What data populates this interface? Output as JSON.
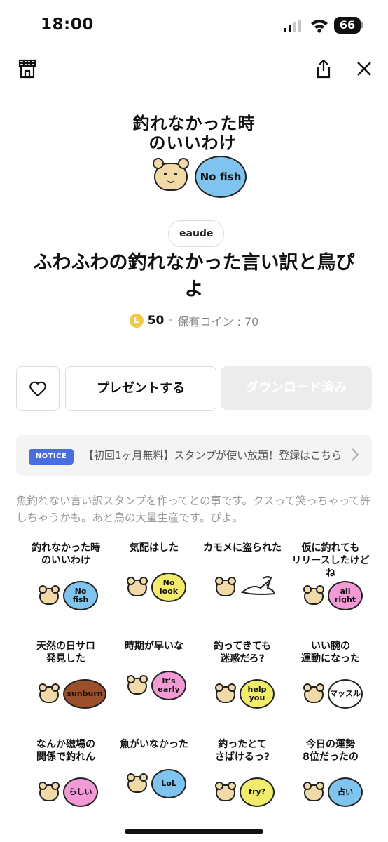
{
  "status_bar": {
    "time": "18:00",
    "battery": "66"
  },
  "hero": {
    "line1": "釣れなかった時",
    "line2": "のいいわけ",
    "bubble": "No fish"
  },
  "package": {
    "author": "eaude",
    "title": "ふわふわの釣れなかった言い訳と鳥ぴよ",
    "coin_symbol": "L",
    "price": "50",
    "separator": "•",
    "coins_owned": "保有コイン : 70"
  },
  "actions": {
    "gift": "プレゼントする",
    "download": "ダウンロード済み"
  },
  "notice": {
    "badge": "NOTICE",
    "text": "【初回1ヶ月無料】スタンプが使い放題！登録はこちら"
  },
  "description": "魚釣れない言い訳スタンプを作ってとの事です。クスって笑っちゃって許しちゃうかも。あと鳥の大量生産です。ぴよ。",
  "stickers": [
    {
      "text": "釣れなかった時\nのいいわけ",
      "bubble": "No\nfish",
      "color": "#7fc4ee"
    },
    {
      "text": "気配はした",
      "bubble": "No\nlook",
      "color": "#f3ec6a"
    },
    {
      "text": "カモメに盗られた",
      "bubble": "",
      "color": ""
    },
    {
      "text": "仮に釣れても\nリリースしたけどね",
      "bubble": "all\nright",
      "color": "#f29ad6"
    },
    {
      "text": "天然の日サロ\n発見した",
      "bubble": "sunburn",
      "color": "#9b4f2a"
    },
    {
      "text": "時期が早いな",
      "bubble": "It's\nearly",
      "color": "#f29ad6"
    },
    {
      "text": "釣ってきても\n迷惑だろ?",
      "bubble": "help\nyou",
      "color": "#f3ec6a"
    },
    {
      "text": "いい腕の\n運動になった",
      "bubble": "マッスル",
      "color": "#ffffff"
    },
    {
      "text": "なんか磁場の\n関係で釣れん",
      "bubble": "らしい",
      "color": "#f29ad6"
    },
    {
      "text": "魚がいなかった",
      "bubble": "LoL",
      "color": "#7fc4ee"
    },
    {
      "text": "釣ったとて\nさばけるっ?",
      "bubble": "try?",
      "color": "#f3ec6a"
    },
    {
      "text": "今日の運勢\n8位だったの",
      "bubble": "占い",
      "color": "#7fc4ee"
    }
  ]
}
